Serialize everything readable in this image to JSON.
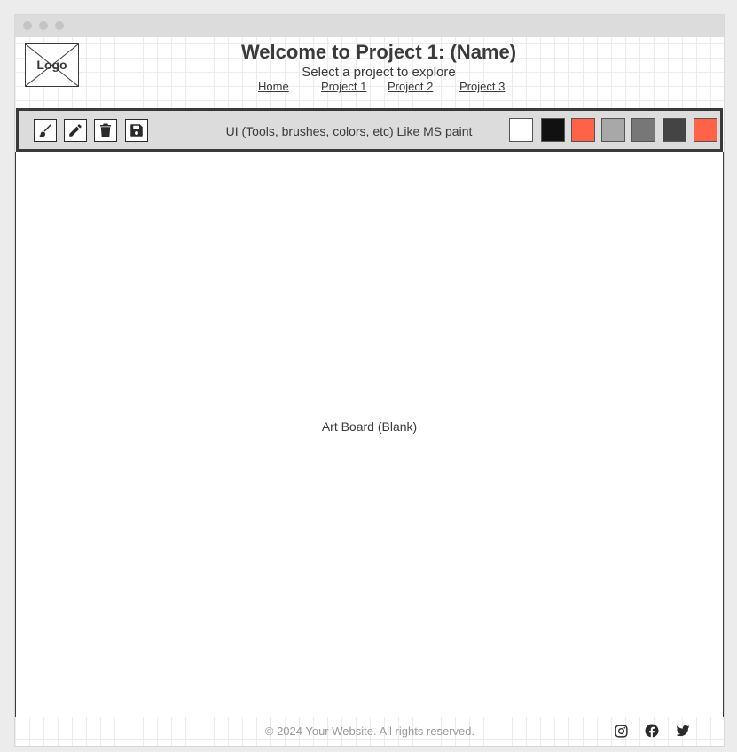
{
  "header": {
    "logo_text": "Logo",
    "title": "Welcome to Project 1: (Name)",
    "subtitle": "Select a project to explore",
    "nav": [
      "Home",
      "Project 1",
      "Project 2",
      "Project 3"
    ]
  },
  "toolbar": {
    "tools": [
      "brush-icon",
      "pencil-icon",
      "trash-icon",
      "save-icon"
    ],
    "label": "UI (Tools, brushes, colors, etc) Like MS paint",
    "swatches": [
      "#ffffff",
      "#111111",
      "#ff6347",
      "#a8a8a8",
      "#777777",
      "#444444",
      "#ff6347"
    ]
  },
  "artboard": {
    "label": "Art Board (Blank)"
  },
  "footer": {
    "copyright": "© 2024 Your Website. All rights reserved.",
    "social": [
      "instagram-icon",
      "facebook-icon",
      "twitter-icon"
    ]
  },
  "colors": {
    "background": "#ececec",
    "text": "#3a3a3a",
    "toolbar_bg": "#dcdcdc",
    "footer_text": "#9a9a9a"
  }
}
